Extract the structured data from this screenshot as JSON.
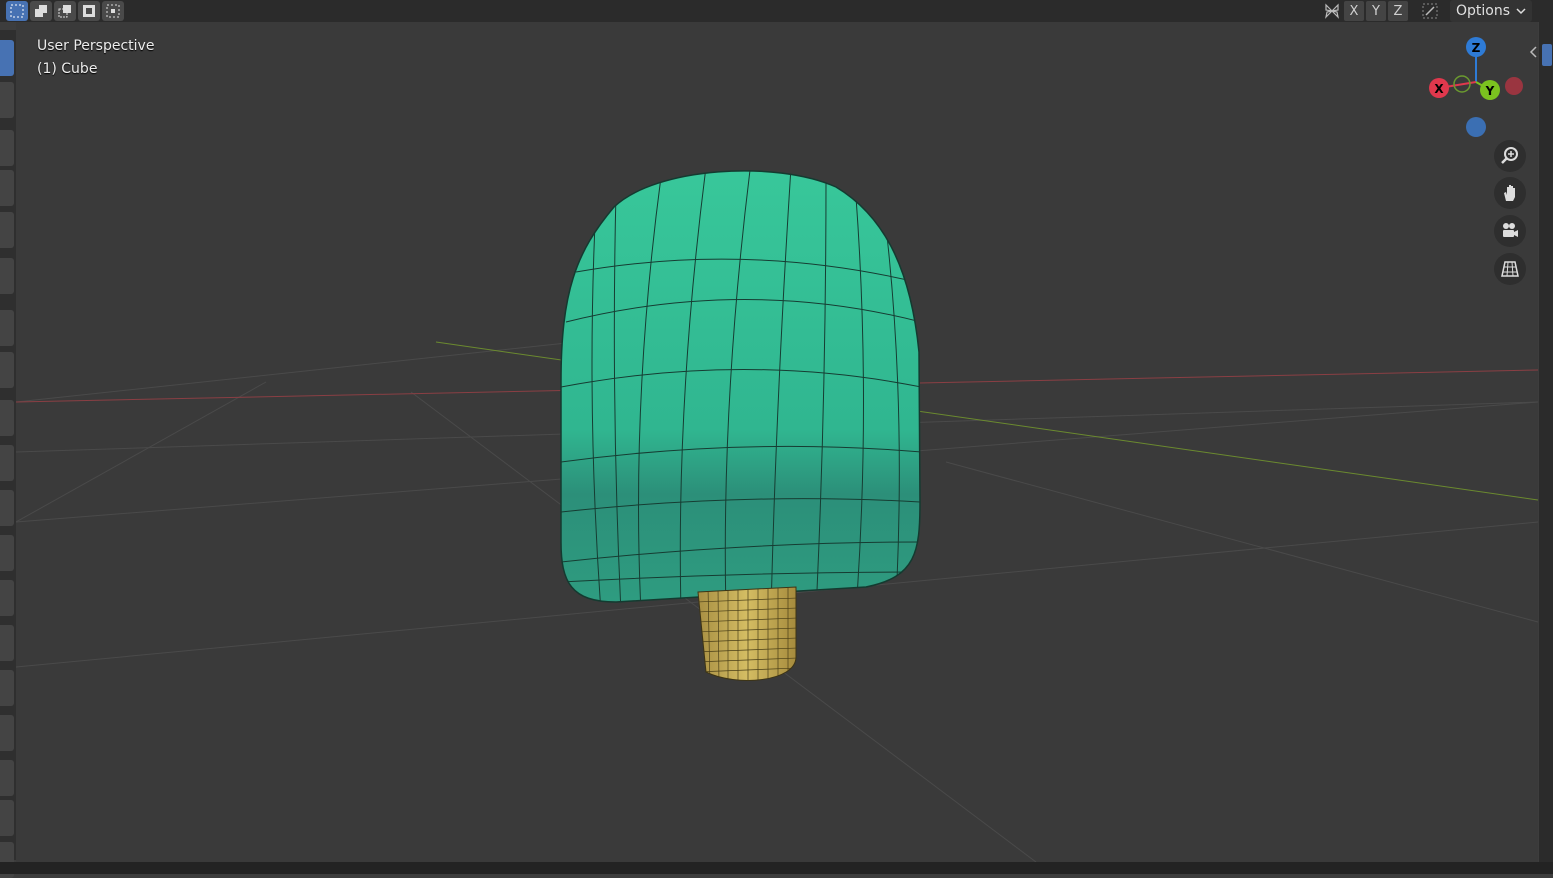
{
  "header": {
    "select_modes": [
      "select-box-icon",
      "select-extend-icon",
      "select-subtract-icon",
      "select-invert-icon",
      "select-intersect-icon"
    ],
    "axes": [
      "X",
      "Y",
      "Z"
    ],
    "options_label": "Options"
  },
  "viewport": {
    "perspective_label": "User Perspective",
    "object_label": "(1) Cube",
    "background_color": "#3a3a3a",
    "mesh_top_color": "#35c497",
    "mesh_bottom_color": "#2a8f78",
    "stick_color": "#c9b25a"
  },
  "gizmo": {
    "x_label": "X",
    "y_label": "Y",
    "z_label": "Z",
    "x_color": "#e0384d",
    "y_color": "#7bc21f",
    "z_color": "#2e7bd6"
  },
  "nav_buttons": [
    "zoom-icon",
    "pan-hand-icon",
    "camera-icon",
    "grid-ortho-icon"
  ]
}
